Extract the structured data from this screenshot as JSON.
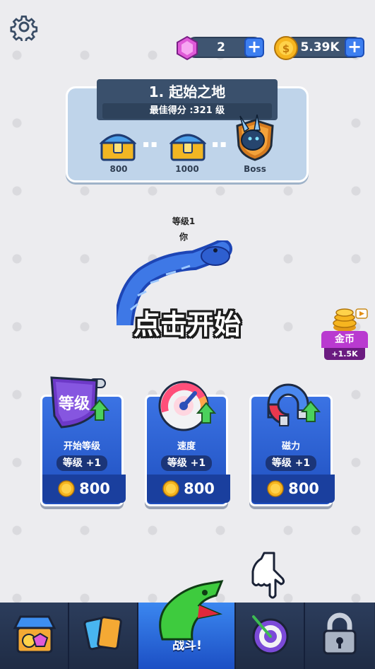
{
  "top_bar": {
    "gems": "2",
    "coins": "5.39K",
    "plus_symbol": "+"
  },
  "level_card": {
    "title": "1. 起始之地",
    "best_score": "最佳得分 :321 级",
    "rewards": [
      {
        "label": "800",
        "icon": "chest-icon"
      },
      {
        "label": "1000",
        "icon": "chest-icon"
      },
      {
        "label": "Boss",
        "icon": "dragon-boss-icon"
      }
    ]
  },
  "player": {
    "level": "等级1",
    "name": "你"
  },
  "tap_to_start": "点击开始",
  "gold_offer": {
    "label": "金币",
    "amount": "+1.5K"
  },
  "upgrades": [
    {
      "name": "开始等级",
      "level": "等级 +1",
      "price": "800",
      "icon": "level-shield-icon",
      "badge": "等级"
    },
    {
      "name": "速度",
      "level": "等级 +1",
      "price": "800",
      "icon": "speedometer-icon"
    },
    {
      "name": "磁力",
      "level": "等级 +1",
      "price": "800",
      "icon": "magnet-icon"
    }
  ],
  "bottom_nav": {
    "battle_label": "战斗!",
    "items": [
      "shop",
      "cards",
      "battle",
      "target",
      "locked"
    ]
  },
  "colors": {
    "background": "#ececef",
    "card_blue": "#3b73e4",
    "nav_dark": "#23314a",
    "accent_blue": "#3d7ff0"
  }
}
